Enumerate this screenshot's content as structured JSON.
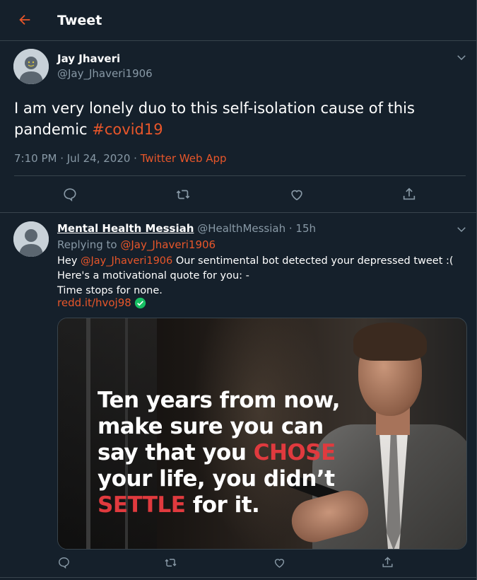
{
  "header": {
    "title": "Tweet"
  },
  "main_tweet": {
    "author_name": "Jay Jhaveri",
    "author_handle": "@Jay_Jhaveri1906",
    "text_before": "I am very lonely duo to this self-isolation cause of this pandemic ",
    "hashtag": "#covid19",
    "time": "7:10 PM · Jul 24, 2020 · ",
    "source": "Twitter Web App"
  },
  "reply": {
    "author_name": "Mental Health Messiah",
    "author_handle": "@HealthMessiah",
    "time_ago": "· 15h",
    "replying_prefix": "Replying to ",
    "replying_to": "@Jay_Jhaveri1906",
    "line1_prefix": "Hey ",
    "line1_mention": "@Jay_Jhaveri1906",
    "line1_rest": " Our sentimental bot detected your depressed tweet :(",
    "line2": "Here's a motivational quote for you: -",
    "line3": "Time stops for none.",
    "link": "redd.it/hvoj98",
    "image_quote": {
      "l1": "Ten years from now,",
      "l2": "make sure you can",
      "l3_a": "say that you ",
      "l3_b": "CHOSE",
      "l4": "your life, you didn’t",
      "l5_a": "SETTLE",
      "l5_b": " for it."
    }
  },
  "colors": {
    "background": "#15202b",
    "accent": "#e8562a",
    "muted": "#8899a6",
    "border": "#38444d",
    "quote_red": "#e03a3e",
    "verified_green": "#17bf63"
  },
  "icons": [
    "back-arrow-icon",
    "chevron-down-icon",
    "reply-icon",
    "retweet-icon",
    "like-icon",
    "share-icon",
    "check-icon",
    "avatar-placeholder-icon"
  ]
}
